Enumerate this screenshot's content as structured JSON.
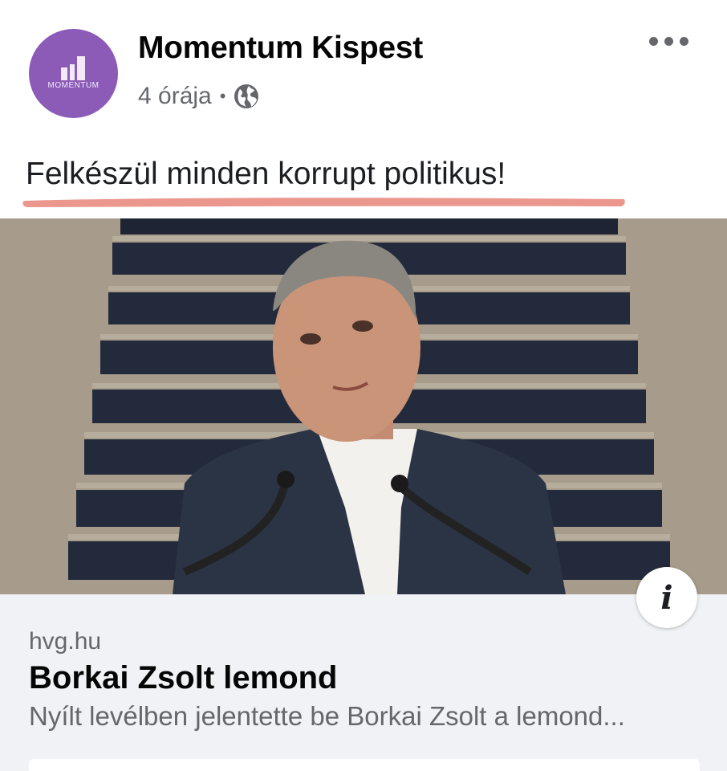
{
  "post": {
    "page_name": "Momentum Kispest",
    "time": "4 órája",
    "separator": "•",
    "privacy_icon": "globe-icon",
    "more_icon": "more-dots-icon",
    "text": "Felkészül minden korrupt politikus!",
    "underline_color": "#e8857a"
  },
  "avatar": {
    "logo_text": "MOMENTUM",
    "color": "#8c5bb8"
  },
  "link_card": {
    "domain": "hvg.hu",
    "title": "Borkai Zsolt lemond",
    "description": "Nyílt levélben jelentette be Borkai Zsolt a lemond...",
    "info_icon": "info-icon"
  }
}
